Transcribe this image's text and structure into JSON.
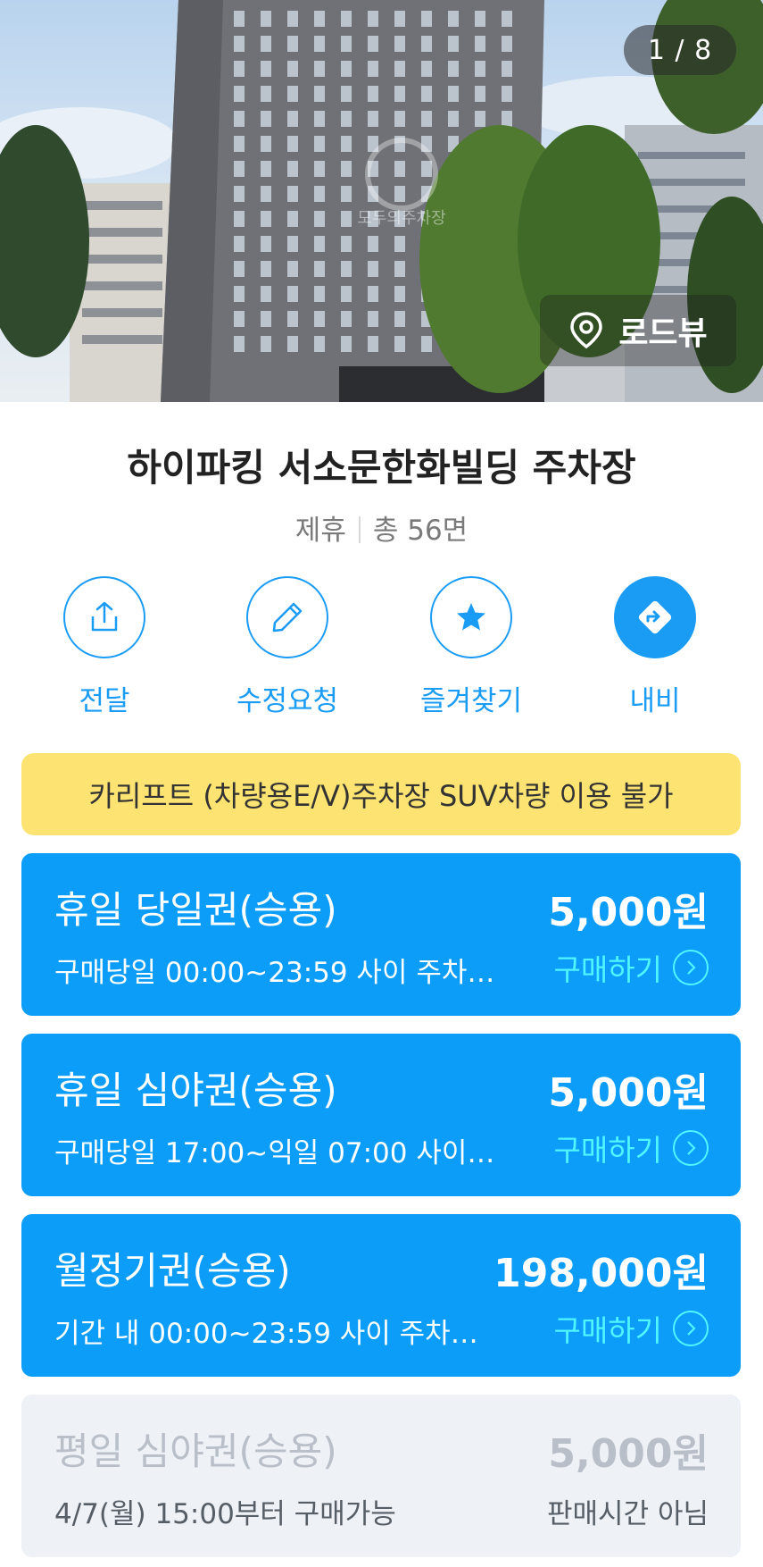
{
  "hero": {
    "counter": "1 / 8",
    "roadview_label": "로드뷰",
    "watermark": "모두의주차장"
  },
  "lot": {
    "name": "하이파킹 서소문한화빌딩 주차장",
    "type": "제휴",
    "spaces": "총 56면"
  },
  "actions": [
    {
      "label": "전달",
      "icon": "share-icon"
    },
    {
      "label": "수정요청",
      "icon": "pencil-icon"
    },
    {
      "label": "즐겨찾기",
      "icon": "star-icon"
    },
    {
      "label": "내비",
      "icon": "navigation-icon"
    }
  ],
  "notice": "카리프트 (차량용E/V)주차장 SUV차량 이용 불가",
  "tickets": [
    {
      "name": "휴일 당일권(승용)",
      "price": "5,000원",
      "desc": "구매당일 00:00~23:59 사이 주차…",
      "action": "구매하기"
    },
    {
      "name": "휴일 심야권(승용)",
      "price": "5,000원",
      "desc": "구매당일 17:00~익일 07:00 사이…",
      "action": "구매하기"
    },
    {
      "name": "월정기권(승용)",
      "price": "198,000원",
      "desc": "기간 내 00:00~23:59 사이 주차…",
      "action": "구매하기"
    },
    {
      "name": "평일 심야권(승용)",
      "price": "5,000원",
      "desc": "4/7(월) 15:00부터 구매가능",
      "status": "판매시간 아님"
    }
  ],
  "colors": {
    "accent": "#1a9cf5",
    "card": "#0c9df9",
    "buy_text": "#4ff5ff",
    "notice_bg": "#fde372",
    "disabled_bg": "#eef1f5"
  }
}
